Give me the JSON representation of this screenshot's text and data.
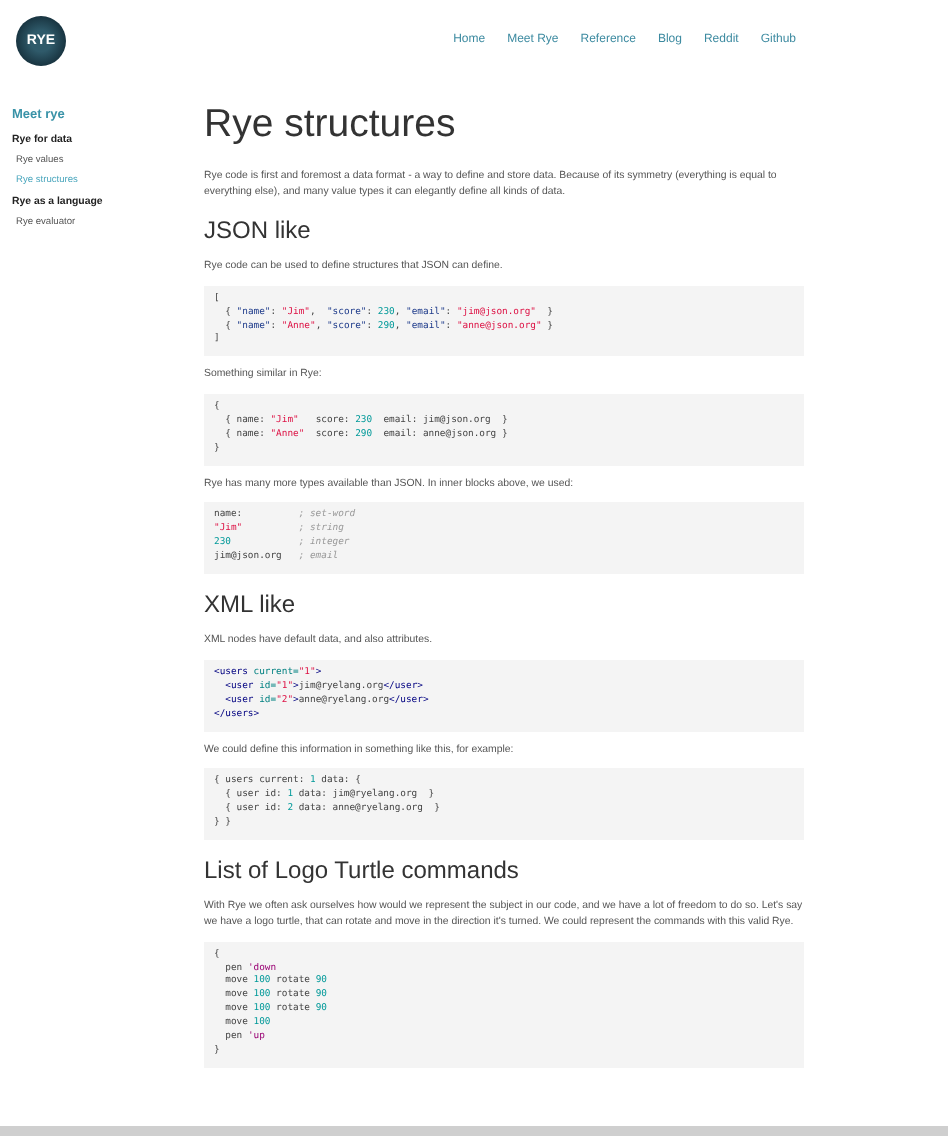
{
  "header": {
    "logo_text": "RYE",
    "nav": [
      {
        "label": "Home"
      },
      {
        "label": "Meet Rye"
      },
      {
        "label": "Reference"
      },
      {
        "label": "Blog"
      },
      {
        "label": "Reddit"
      },
      {
        "label": "Github"
      }
    ]
  },
  "sidebar": {
    "title": "Meet rye",
    "items": [
      {
        "kind": "group",
        "label": "Rye for data"
      },
      {
        "kind": "link",
        "label": "Rye values",
        "selected": false
      },
      {
        "kind": "link",
        "label": "Rye structures",
        "selected": true
      },
      {
        "kind": "group",
        "label": "Rye as a language"
      },
      {
        "kind": "link",
        "label": "Rye evaluator",
        "selected": false
      }
    ]
  },
  "content": [
    {
      "kind": "h1",
      "text": "Rye structures"
    },
    {
      "kind": "p",
      "text": "Rye code is first and foremost a data format - a way to define and store data. Because of its symmetry (everything is equal to everything else), and many value types it can elegantly define all kinds of data."
    },
    {
      "kind": "h2",
      "text": "JSON like"
    },
    {
      "kind": "p",
      "text": "Rye code can be used to define structures that JSON can define."
    },
    {
      "kind": "code",
      "lines": [
        [
          {
            "kind": "plain",
            "text": "["
          }
        ],
        [
          {
            "kind": "plain",
            "text": "  { "
          },
          {
            "kind": "key",
            "text": "\"name\""
          },
          {
            "kind": "plain",
            "text": ": "
          },
          {
            "kind": "string",
            "text": "\"Jim\""
          },
          {
            "kind": "plain",
            "text": ",  "
          },
          {
            "kind": "key",
            "text": "\"score\""
          },
          {
            "kind": "plain",
            "text": ": "
          },
          {
            "kind": "number",
            "text": "230"
          },
          {
            "kind": "plain",
            "text": ", "
          },
          {
            "kind": "key",
            "text": "\"email\""
          },
          {
            "kind": "plain",
            "text": ": "
          },
          {
            "kind": "string",
            "text": "\"jim@json.org\""
          },
          {
            "kind": "plain",
            "text": "  }"
          }
        ],
        [
          {
            "kind": "plain",
            "text": "  { "
          },
          {
            "kind": "key",
            "text": "\"name\""
          },
          {
            "kind": "plain",
            "text": ": "
          },
          {
            "kind": "string",
            "text": "\"Anne\""
          },
          {
            "kind": "plain",
            "text": ", "
          },
          {
            "kind": "key",
            "text": "\"score\""
          },
          {
            "kind": "plain",
            "text": ": "
          },
          {
            "kind": "number",
            "text": "290"
          },
          {
            "kind": "plain",
            "text": ", "
          },
          {
            "kind": "key",
            "text": "\"email\""
          },
          {
            "kind": "plain",
            "text": ": "
          },
          {
            "kind": "string",
            "text": "\"anne@json.org\""
          },
          {
            "kind": "plain",
            "text": " }"
          }
        ],
        [
          {
            "kind": "plain",
            "text": "]"
          }
        ]
      ]
    },
    {
      "kind": "p",
      "text": "Something similar in Rye:"
    },
    {
      "kind": "code",
      "lines": [
        [
          {
            "kind": "plain",
            "text": "{"
          }
        ],
        [
          {
            "kind": "plain",
            "text": "  { name: "
          },
          {
            "kind": "string",
            "text": "\"Jim\""
          },
          {
            "kind": "plain",
            "text": "   score: "
          },
          {
            "kind": "number",
            "text": "230"
          },
          {
            "kind": "plain",
            "text": "  email: jim@json.org  }"
          }
        ],
        [
          {
            "kind": "plain",
            "text": "  { name: "
          },
          {
            "kind": "string",
            "text": "\"Anne\""
          },
          {
            "kind": "plain",
            "text": "  score: "
          },
          {
            "kind": "number",
            "text": "290"
          },
          {
            "kind": "plain",
            "text": "  email: anne@json.org }"
          }
        ],
        [
          {
            "kind": "plain",
            "text": "}"
          }
        ]
      ]
    },
    {
      "kind": "p",
      "text": "Rye has many more types available than JSON. In inner blocks above, we used:"
    },
    {
      "kind": "code",
      "lines": [
        [
          {
            "kind": "plain",
            "text": "name:          "
          },
          {
            "kind": "comment",
            "text": "; set-word"
          }
        ],
        [
          {
            "kind": "string",
            "text": "\"Jim\""
          },
          {
            "kind": "comment",
            "text": "          ; string"
          }
        ],
        [
          {
            "kind": "number",
            "text": "230"
          },
          {
            "kind": "comment",
            "text": "            ; integer"
          }
        ],
        [
          {
            "kind": "plain",
            "text": "jim@json.org   "
          },
          {
            "kind": "comment",
            "text": "; email"
          }
        ]
      ]
    },
    {
      "kind": "h2",
      "text": "XML like"
    },
    {
      "kind": "p",
      "text": "XML nodes have default data, and also attributes."
    },
    {
      "kind": "code",
      "lines": [
        [
          {
            "kind": "tag",
            "text": "<users"
          },
          {
            "kind": "attr",
            "text": " current="
          },
          {
            "kind": "string",
            "text": "\"1\""
          },
          {
            "kind": "tag",
            "text": ">"
          }
        ],
        [
          {
            "kind": "tag",
            "text": "  <user"
          },
          {
            "kind": "attr",
            "text": " id="
          },
          {
            "kind": "string",
            "text": "\"1\""
          },
          {
            "kind": "tag",
            "text": ">"
          },
          {
            "kind": "plain",
            "text": "jim@ryelang.org"
          },
          {
            "kind": "tag",
            "text": "</user>"
          }
        ],
        [
          {
            "kind": "tag",
            "text": "  <user"
          },
          {
            "kind": "attr",
            "text": " id="
          },
          {
            "kind": "string",
            "text": "\"2\""
          },
          {
            "kind": "tag",
            "text": ">"
          },
          {
            "kind": "plain",
            "text": "anne@ryelang.org"
          },
          {
            "kind": "tag",
            "text": "</user>"
          }
        ],
        [
          {
            "kind": "tag",
            "text": "</users>"
          }
        ]
      ]
    },
    {
      "kind": "p",
      "text": "We could define this information in something like this, for example:"
    },
    {
      "kind": "code",
      "lines": [
        [
          {
            "kind": "plain",
            "text": "{ users current: "
          },
          {
            "kind": "number",
            "text": "1"
          },
          {
            "kind": "plain",
            "text": " data: {"
          }
        ],
        [
          {
            "kind": "plain",
            "text": "  { user id: "
          },
          {
            "kind": "number",
            "text": "1"
          },
          {
            "kind": "plain",
            "text": " data: jim@ryelang.org  }"
          }
        ],
        [
          {
            "kind": "plain",
            "text": "  { user id: "
          },
          {
            "kind": "number",
            "text": "2"
          },
          {
            "kind": "plain",
            "text": " data: anne@ryelang.org  }"
          }
        ],
        [
          {
            "kind": "plain",
            "text": "} }"
          }
        ]
      ]
    },
    {
      "kind": "h2",
      "text": "List of Logo Turtle commands"
    },
    {
      "kind": "p",
      "text": "With Rye we often ask ourselves how would we represent the subject in our code, and we have a lot of freedom to do so. Let's say we have a logo turtle, that can rotate and move in the direction it's turned. We could represent the commands with this valid Rye."
    },
    {
      "kind": "code",
      "lines": [
        [
          {
            "kind": "plain",
            "text": "{"
          }
        ],
        [
          {
            "kind": "plain",
            "text": "  pen "
          },
          {
            "kind": "word",
            "text": "'down"
          }
        ],
        [
          {
            "kind": "plain",
            "text": "  move "
          },
          {
            "kind": "number",
            "text": "100"
          },
          {
            "kind": "plain",
            "text": " rotate "
          },
          {
            "kind": "number",
            "text": "90"
          }
        ],
        [
          {
            "kind": "plain",
            "text": "  move "
          },
          {
            "kind": "number",
            "text": "100"
          },
          {
            "kind": "plain",
            "text": " rotate "
          },
          {
            "kind": "number",
            "text": "90"
          }
        ],
        [
          {
            "kind": "plain",
            "text": "  move "
          },
          {
            "kind": "number",
            "text": "100"
          },
          {
            "kind": "plain",
            "text": " rotate "
          },
          {
            "kind": "number",
            "text": "90"
          }
        ],
        [
          {
            "kind": "plain",
            "text": "  move "
          },
          {
            "kind": "number",
            "text": "100"
          }
        ],
        [
          {
            "kind": "plain",
            "text": "  pen "
          },
          {
            "kind": "word",
            "text": "'up"
          }
        ],
        [
          {
            "kind": "plain",
            "text": "}"
          }
        ]
      ]
    }
  ]
}
